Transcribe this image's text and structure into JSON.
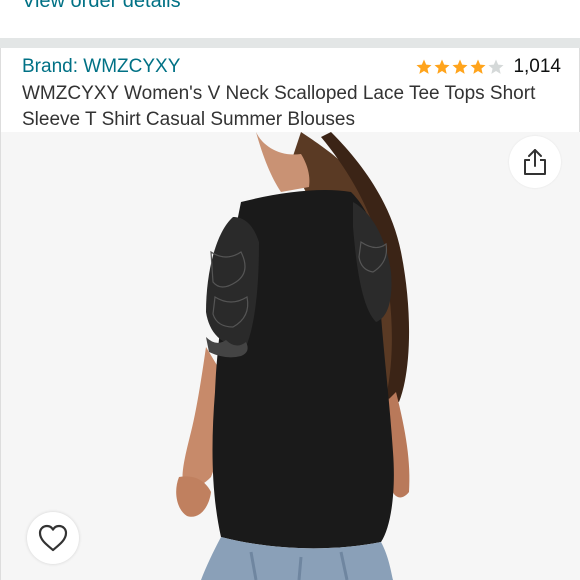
{
  "order": {
    "view_details_label": "View order details"
  },
  "product": {
    "brand_label": "Brand: WMZCYXY",
    "rating_value": 4.0,
    "rating_max": 5,
    "review_count": "1,014",
    "title": "WMZCYXY Women's V Neck Scalloped Lace Tee Tops Short Sleeve T Shirt Casual Summer Blouses",
    "image_icon": "product-photo-black-lace-tee"
  },
  "actions": {
    "share_icon": "share-icon",
    "wishlist_icon": "heart-outline-icon"
  },
  "colors": {
    "link": "#007185",
    "star_filled": "#ffa41c",
    "star_empty": "#d5d9d9",
    "title_text": "#333333",
    "divider": "#e3e6e6"
  }
}
